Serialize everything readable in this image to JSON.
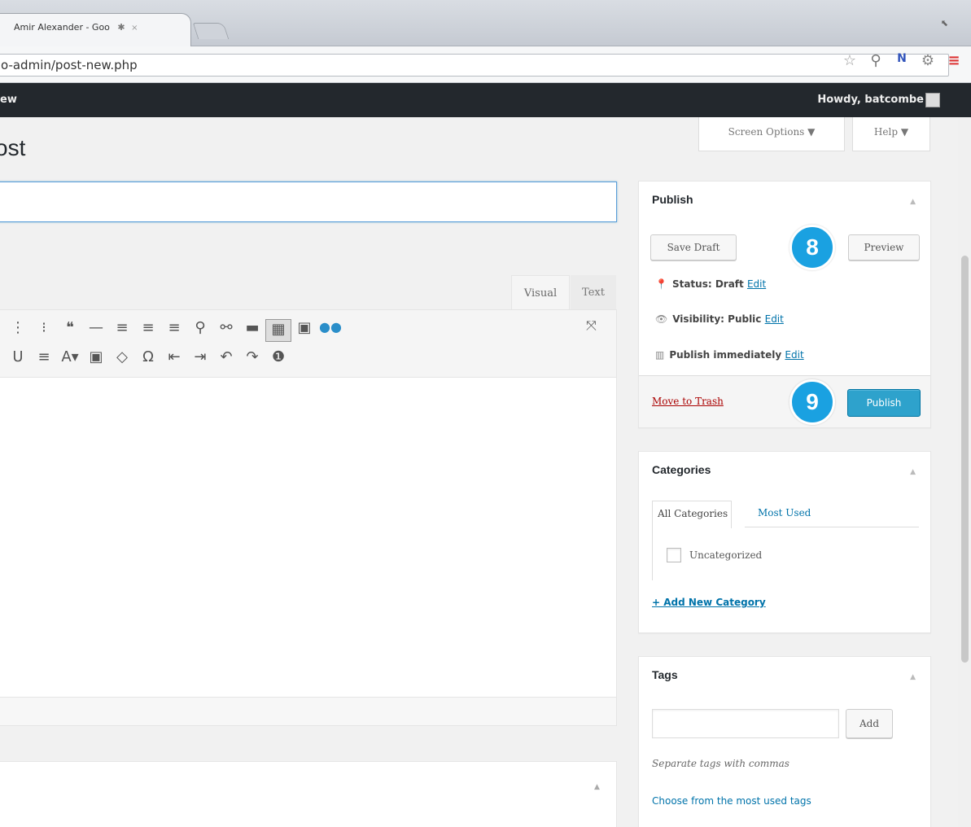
{
  "browser": {
    "tab_title": "Amir Alexander - Goo",
    "tab_pin": "✱",
    "tab_close": "×",
    "url": "o-admin/post-new.php",
    "restore_glyph": "⬉"
  },
  "adminbar": {
    "new_label": "ew",
    "howdy": "Howdy, batcombe"
  },
  "screen": {
    "options_label": "Screen Options ▼",
    "help_label": "Help ▼"
  },
  "page": {
    "title": "ost"
  },
  "editor": {
    "tab_visual": "Visual",
    "tab_text": "Text",
    "row1": [
      "⋮",
      "⁝",
      "❝",
      "—",
      "≡",
      "≡",
      "≡",
      "⚲",
      "⚯",
      "▬",
      "▦",
      "▣",
      "●●"
    ],
    "row2": [
      "U",
      "≡",
      "A▾",
      "▣",
      "◇",
      "Ω",
      "⇤",
      "⇥",
      "↶",
      "↷",
      "❶"
    ]
  },
  "publish": {
    "title": "Publish",
    "save_draft": "Save Draft",
    "preview": "Preview",
    "status_label": "Status: Draft",
    "visibility_label": "Visibility: Public",
    "schedule_label": "Publish immediately",
    "edit_link": "Edit",
    "trash": "Move to Trash",
    "publish_button": "Publish"
  },
  "badges": {
    "step8": "8",
    "step9": "9",
    "color": "#1aa1e1"
  },
  "categories": {
    "title": "Categories",
    "tab_all": "All Categories",
    "tab_used": "Most Used",
    "item": "Uncategorized",
    "add_new": "+ Add New Category"
  },
  "tags": {
    "title": "Tags",
    "add_button": "Add",
    "help": "Separate tags with commas",
    "choose": "Choose from the most used tags"
  },
  "colors": {
    "primary": "#2ea2cc",
    "admin_bar": "#23282d",
    "trash": "#a00",
    "link": "#0073aa"
  }
}
